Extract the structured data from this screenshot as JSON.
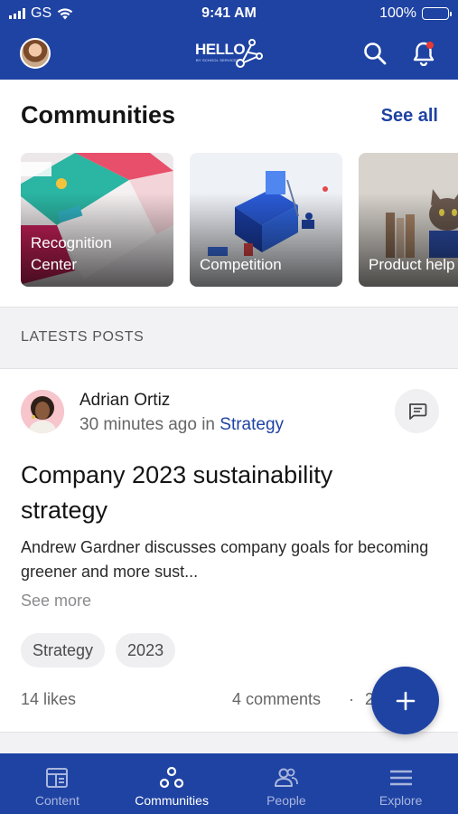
{
  "status_bar": {
    "carrier": "GS",
    "time": "9:41 AM",
    "battery": "100%",
    "battery_level": 1.0
  },
  "header": {
    "logo_text": "HELLO",
    "logo_tagline": "BY SCHOOL SERVICES"
  },
  "communities": {
    "title": "Communities",
    "see_all": "See all",
    "cards": [
      {
        "label": "Recognition\nCenter"
      },
      {
        "label": "Competition"
      },
      {
        "label": "Product help"
      }
    ]
  },
  "latest_posts": {
    "title": "LATESTS POSTS"
  },
  "post": {
    "author": "Adrian Ortiz",
    "time_ago": "30 minutes ago in ",
    "community": "Strategy",
    "title": "Company 2023 sustainability strategy",
    "excerpt": "Andrew Gardner discusses company goals for becoming greener and more sust...",
    "see_more": "See more",
    "tags": [
      "Strategy",
      "2023"
    ],
    "likes": "14 likes",
    "comments": "4 comments",
    "separator": "·",
    "shares_partial": "2"
  },
  "tabbar": {
    "items": [
      {
        "label": "Content",
        "icon": "content-icon"
      },
      {
        "label": "Communities",
        "icon": "communities-icon",
        "active": true
      },
      {
        "label": "People",
        "icon": "people-icon"
      },
      {
        "label": "Explore",
        "icon": "menu-icon"
      }
    ]
  },
  "colors": {
    "brand": "#1f43a3",
    "notification": "#e53935"
  }
}
